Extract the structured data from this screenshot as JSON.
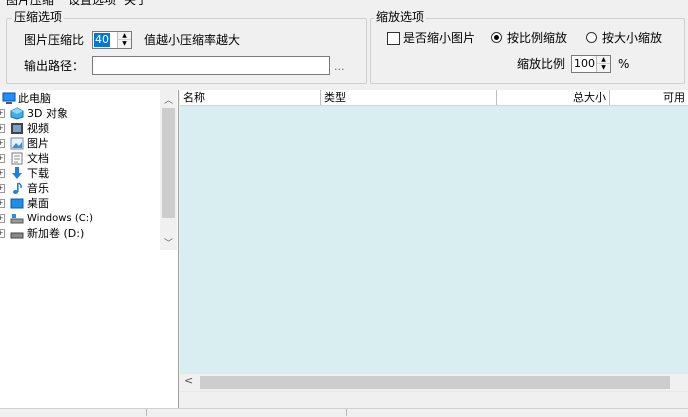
{
  "menu": {
    "items": [
      "图片压缩",
      "设置选项",
      "关于"
    ]
  },
  "compress_group": {
    "legend": "压缩选项",
    "ratio_label": "图片压缩比",
    "ratio_value": "40",
    "ratio_hint": "值越小压缩率越大",
    "output_label": "输出路径：",
    "output_value": "",
    "browse_label": "..."
  },
  "scale_group": {
    "legend": "缩放选项",
    "shrink_checkbox_label": "是否缩小图片",
    "shrink_checked": false,
    "radio_ratio_label": "按比例缩放",
    "radio_size_label": "按大小缩放",
    "selected_radio": "ratio",
    "scale_label": "缩放比例",
    "scale_value": "100",
    "scale_unit": "%"
  },
  "tree": {
    "items": [
      {
        "label": "此电脑",
        "icon": "computer-icon"
      },
      {
        "label": "3D 对象",
        "icon": "3d-objects-icon"
      },
      {
        "label": "视频",
        "icon": "video-icon"
      },
      {
        "label": "图片",
        "icon": "pictures-icon"
      },
      {
        "label": "文档",
        "icon": "documents-icon"
      },
      {
        "label": "下载",
        "icon": "downloads-icon"
      },
      {
        "label": "音乐",
        "icon": "music-icon"
      },
      {
        "label": "桌面",
        "icon": "desktop-icon"
      },
      {
        "label": "Windows (C:)",
        "icon": "drive-icon"
      },
      {
        "label": "新加卷 (D:)",
        "icon": "drive-icon"
      }
    ]
  },
  "file_list": {
    "columns": [
      "名称",
      "类型",
      "总大小",
      "可用"
    ]
  },
  "colors": {
    "list_bg": "#d9eef0",
    "selection": "#0078d7"
  }
}
